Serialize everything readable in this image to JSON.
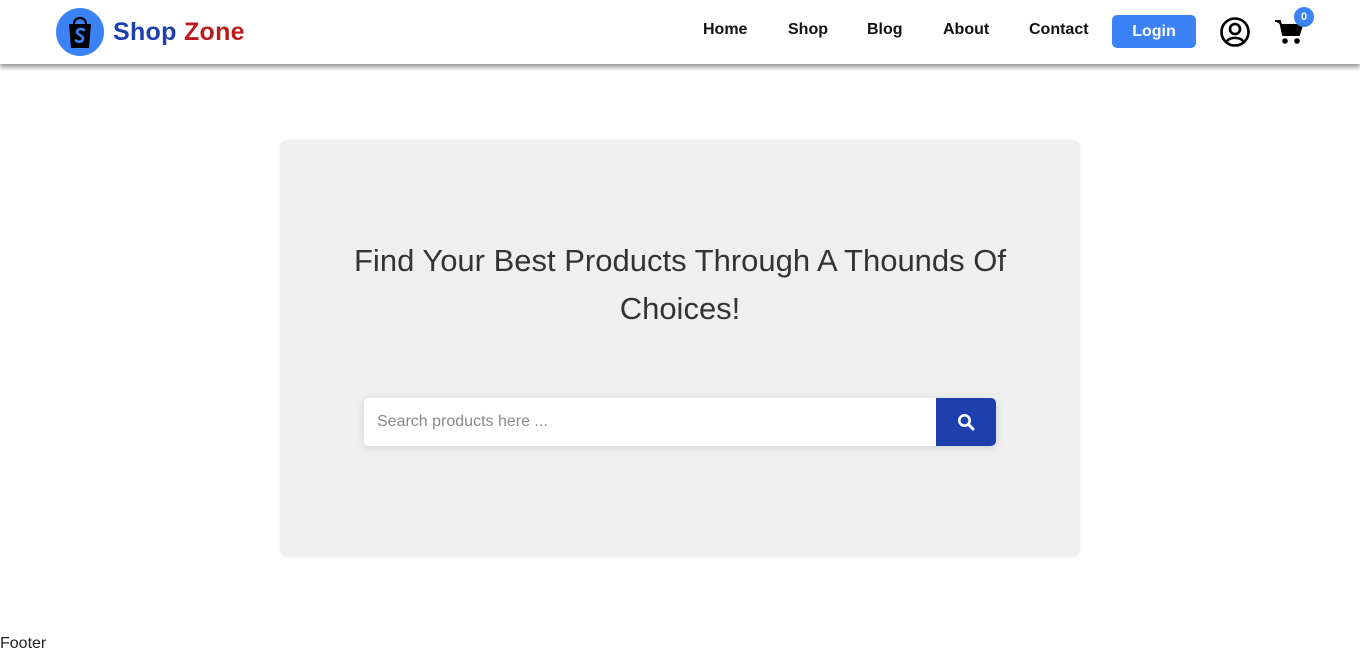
{
  "brand": {
    "name_part1": "Shop",
    "name_part2": "Zone"
  },
  "nav": {
    "items": [
      {
        "label": "Home"
      },
      {
        "label": "Shop"
      },
      {
        "label": "Blog"
      },
      {
        "label": "About"
      },
      {
        "label": "Contact"
      }
    ],
    "login_label": "Login",
    "cart_count": "0"
  },
  "hero": {
    "title": "Find Your Best Products Through A Thounds Of Choices!",
    "search": {
      "placeholder": "Search products here ...",
      "value": ""
    }
  },
  "footer": {
    "text": "Footer"
  },
  "colors": {
    "accent": "#3b82f6",
    "brand_blue": "#1e40af",
    "brand_red": "#b91c1c",
    "hero_bg": "#efefef"
  },
  "icons": {
    "logo": "shopping-bag-icon",
    "user": "user-circle-icon",
    "cart": "shopping-cart-icon",
    "search": "search-icon"
  }
}
